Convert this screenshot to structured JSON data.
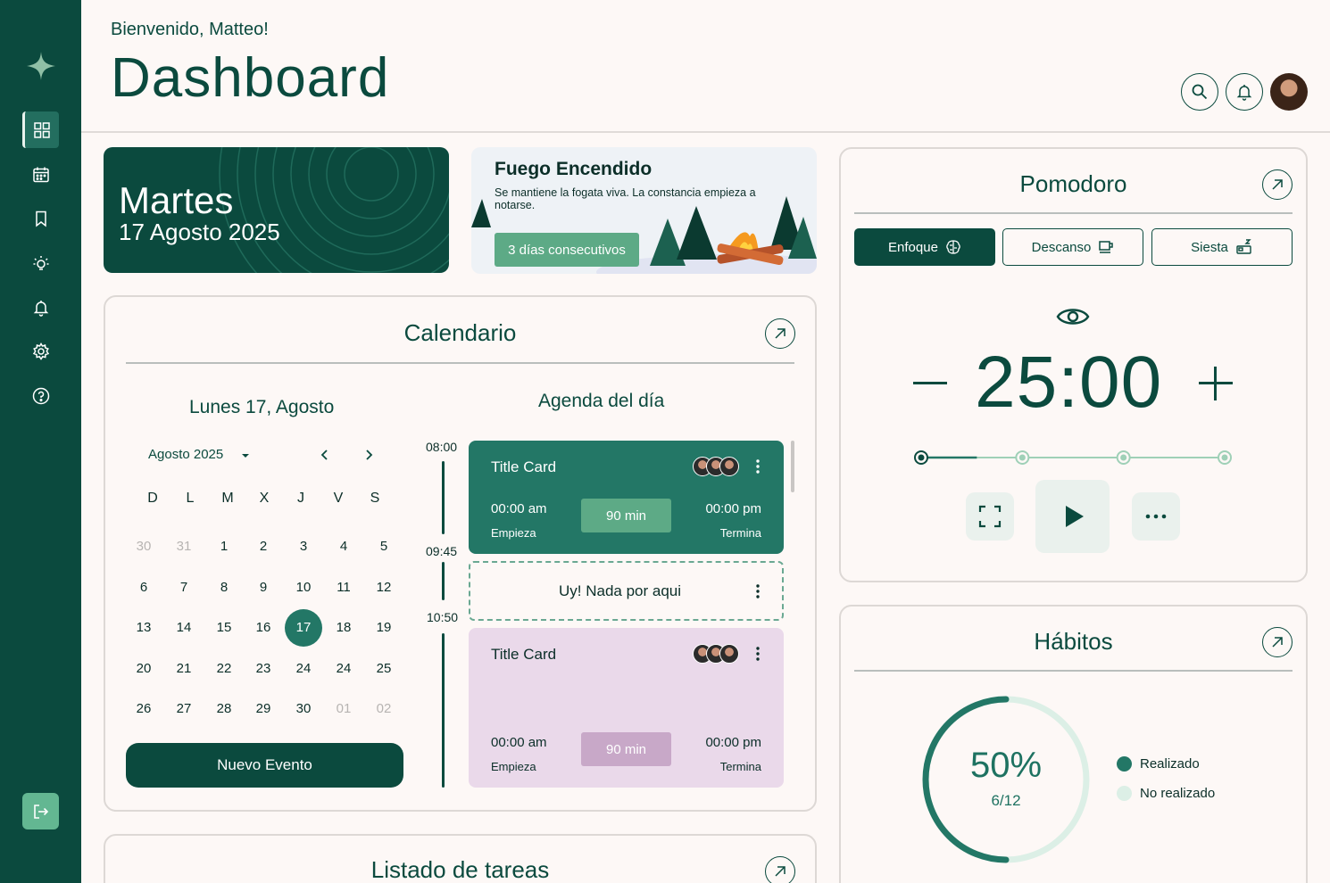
{
  "header": {
    "greeting": "Bienvenido, Matteo!",
    "title": "Dashboard"
  },
  "date_card": {
    "day_name": "Martes",
    "date": "17 Agosto 2025"
  },
  "streak_card": {
    "title": "Fuego Encendido",
    "subtitle": "Se mantiene la fogata viva. La constancia empieza a notarse.",
    "badge": "3 días consecutivos"
  },
  "calendar": {
    "title": "Calendario",
    "selected_label": "Lunes 17, Agosto",
    "month_label": "Agosto 2025",
    "weekdays": [
      "D",
      "L",
      "M",
      "X",
      "J",
      "V",
      "S"
    ],
    "weeks": [
      [
        "30",
        "31",
        "1",
        "2",
        "3",
        "4",
        "5"
      ],
      [
        "6",
        "7",
        "8",
        "9",
        "10",
        "11",
        "12"
      ],
      [
        "13",
        "14",
        "15",
        "16",
        "17",
        "18",
        "19"
      ],
      [
        "20",
        "21",
        "22",
        "23",
        "24",
        "24",
        "25"
      ],
      [
        "26",
        "27",
        "28",
        "29",
        "30",
        "01",
        "02"
      ]
    ],
    "new_event_label": "Nuevo Evento"
  },
  "agenda": {
    "title": "Agenda del día",
    "times": [
      "08:00",
      "09:45",
      "10:50"
    ],
    "events": [
      {
        "title": "Title Card",
        "start": "00:00 am",
        "start_label": "Empieza",
        "duration": "90 min",
        "end": "00:00 pm",
        "end_label": "Termina"
      },
      {
        "title": "Title Card",
        "start": "00:00 am",
        "start_label": "Empieza",
        "duration": "90 min",
        "end": "00:00 pm",
        "end_label": "Termina"
      }
    ],
    "empty_label": "Uy! Nada por aqui"
  },
  "tasks": {
    "title": "Listado de tareas"
  },
  "pomodoro": {
    "title": "Pomodoro",
    "modes": [
      "Enfoque",
      "Descanso",
      "Siesta"
    ],
    "active_mode": "Enfoque",
    "timer": "25:00",
    "steps_total": 4,
    "steps_current": 1
  },
  "habits": {
    "title": "Hábitos",
    "percent": "50%",
    "ratio": "6/12",
    "progress": 0.5,
    "legend": [
      "Realizado",
      "No realizado"
    ],
    "colors": {
      "done": "#237766",
      "pending": "#dcefe6"
    }
  },
  "icons": [
    "sparkle-icon",
    "grid-icon",
    "calendar-icon",
    "bookmark-icon",
    "bulb-icon",
    "bell-icon",
    "gear-icon",
    "help-icon",
    "logout-icon",
    "search-icon",
    "expand-icon",
    "brain-icon",
    "coffee-icon",
    "bed-icon",
    "eye-icon",
    "fullscreen-icon",
    "play-icon",
    "more-icon",
    "fire-icon"
  ]
}
